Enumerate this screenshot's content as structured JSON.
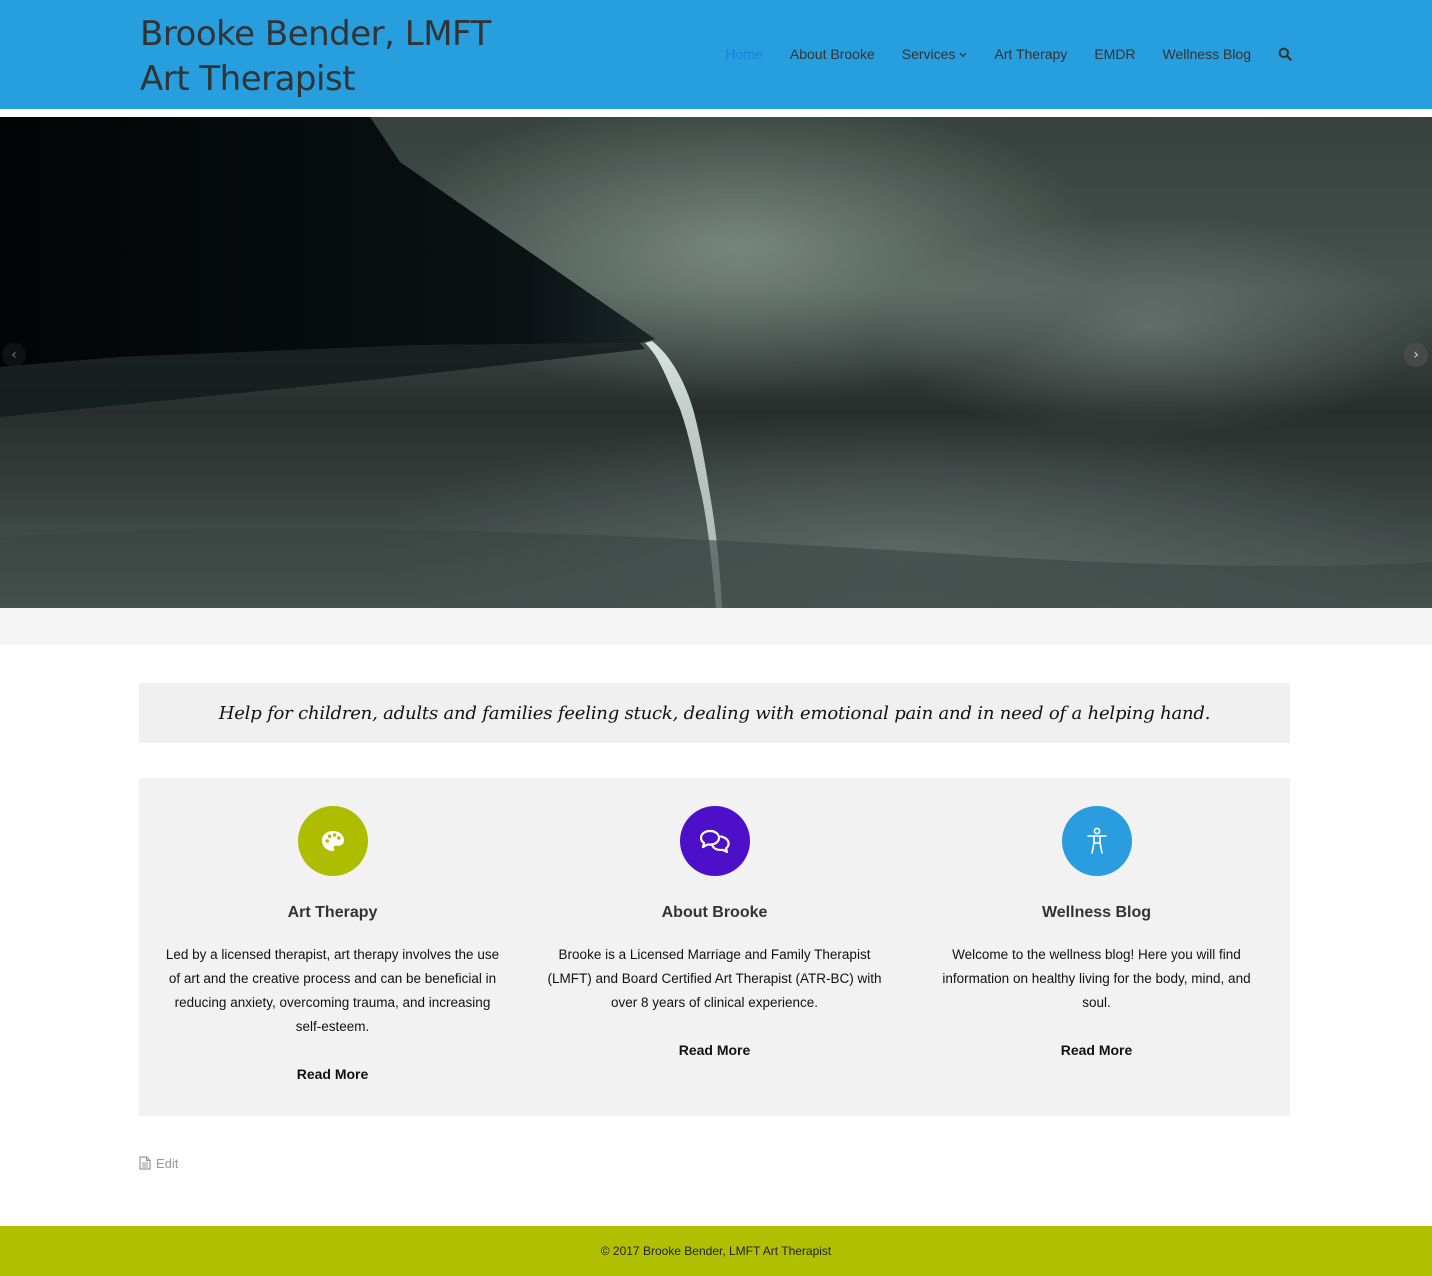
{
  "site": {
    "title_line1": "Brooke Bender, LMFT",
    "title_line2": "Art Therapist"
  },
  "nav": {
    "items": [
      {
        "label": "Home",
        "active": true
      },
      {
        "label": "About Brooke"
      },
      {
        "label": "Services",
        "has_dropdown": true
      },
      {
        "label": "Art Therapy"
      },
      {
        "label": "EMDR"
      },
      {
        "label": "Wellness Blog"
      }
    ],
    "search_icon": "search-icon",
    "active_color": "#1e7fe0"
  },
  "colors": {
    "header_bg": "#279fdf",
    "footer_bg": "#b0c000",
    "feature_1": "#aebd00",
    "feature_2": "#4d0fc8",
    "feature_3": "#2a9de0"
  },
  "slider": {
    "prev_icon": "chevron-left-icon",
    "next_icon": "chevron-right-icon"
  },
  "tagline": "Help for children, adults and families feeling stuck, dealing with emotional pain and in need of a helping hand.",
  "features": [
    {
      "icon": "palette-icon",
      "title": "Art Therapy",
      "description": "Led by a licensed therapist, art therapy involves the use of art and the creative process and can be beneficial in reducing anxiety, overcoming trauma, and increasing self-esteem.",
      "link": "Read More"
    },
    {
      "icon": "comments-icon",
      "title": "About Brooke",
      "description": "Brooke is a Licensed Marriage and Family Therapist (LMFT) and Board Certified Art Therapist (ATR-BC) with over 8 years of clinical experience.",
      "link": "Read More"
    },
    {
      "icon": "accessibility-icon",
      "title": "Wellness Blog",
      "description": "Welcome to the wellness blog! Here you will find information on healthy living for the body, mind, and soul.",
      "link": "Read More"
    }
  ],
  "edit": {
    "label": "Edit",
    "icon": "document-icon"
  },
  "footer": {
    "text": "© 2017 Brooke Bender, LMFT Art Therapist"
  }
}
